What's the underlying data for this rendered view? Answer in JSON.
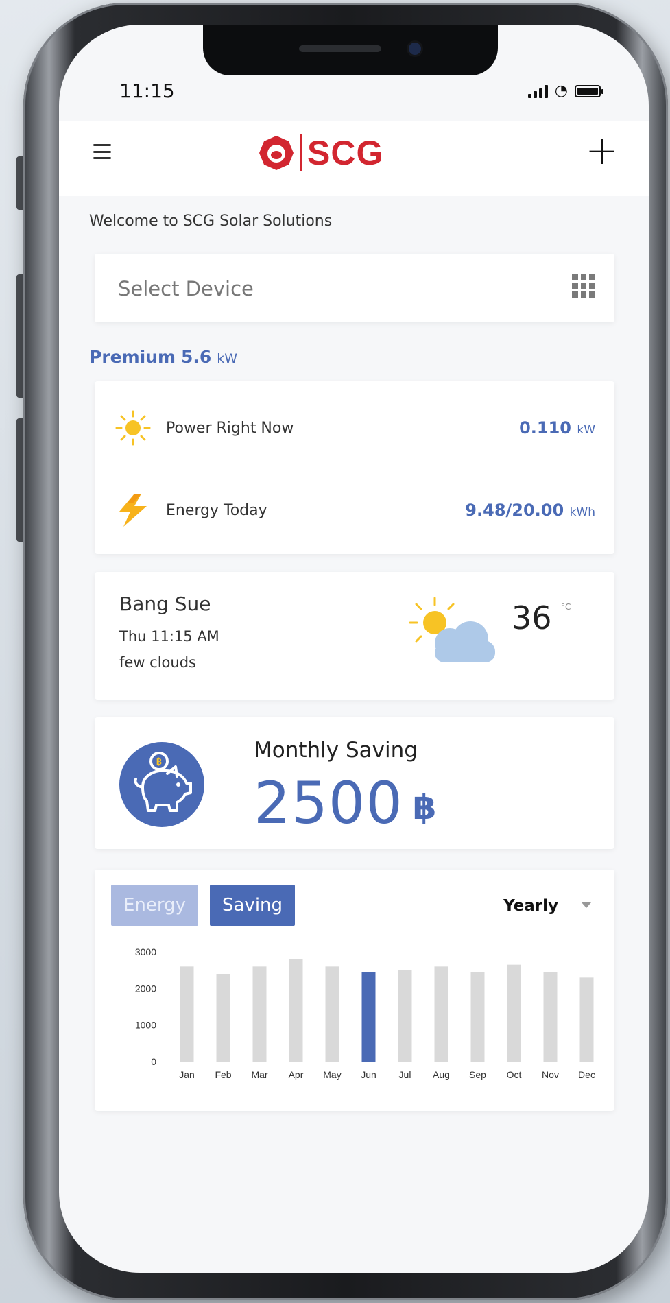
{
  "status_bar": {
    "time": "11:15"
  },
  "header": {
    "brand": "SCG",
    "menu_icon": "hamburger-icon",
    "add_icon": "plus-icon"
  },
  "welcome": "Welcome to SCG Solar Solutions",
  "device_select": {
    "placeholder": "Select Device",
    "icon": "grid-icon"
  },
  "plan": {
    "name": "Premium",
    "size": "5.6",
    "unit": "kW"
  },
  "power": {
    "label": "Power Right Now",
    "value": "0.110",
    "unit": "kW",
    "icon": "sun-icon"
  },
  "energy": {
    "label": "Energy Today",
    "value": "9.48/20.00",
    "unit": "kWh",
    "icon": "lightning-icon"
  },
  "weather": {
    "city": "Bang Sue",
    "datetime": "Thu 11:15 AM",
    "description": "few clouds",
    "temp": "36",
    "unit": "°C",
    "icon": "partly-cloudy-icon"
  },
  "saving": {
    "title": "Monthly Saving",
    "value": "2500",
    "currency": "฿",
    "icon": "piggy-bank-icon"
  },
  "chart_tabs": {
    "energy": "Energy",
    "saving": "Saving",
    "active": "saving",
    "period": "Yearly"
  },
  "colors": {
    "accent": "#4a6ab5",
    "bar": "#d9d9d9",
    "brand_red": "#d22630"
  },
  "chart_data": {
    "type": "bar",
    "categories": [
      "Jan",
      "Feb",
      "Mar",
      "Apr",
      "May",
      "Jun",
      "Jul",
      "Aug",
      "Sep",
      "Oct",
      "Nov",
      "Dec"
    ],
    "values": [
      2600,
      2400,
      2600,
      2800,
      2600,
      2450,
      2500,
      2600,
      2450,
      2650,
      2450,
      2300
    ],
    "highlight": "Jun",
    "yticks": [
      0,
      1000,
      2000,
      3000
    ],
    "ylim": [
      0,
      3000
    ],
    "title": "",
    "xlabel": "",
    "ylabel": "",
    "grid": false
  }
}
